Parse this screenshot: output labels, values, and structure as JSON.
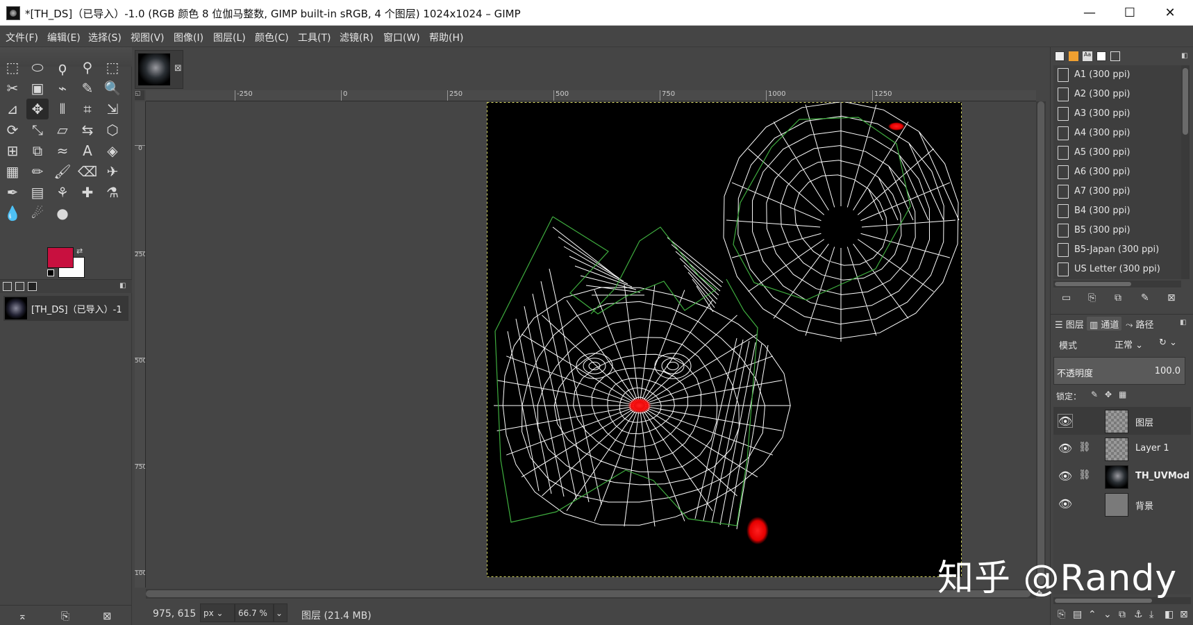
{
  "window": {
    "title": "*[TH_DS]（已导入）-1.0 (RGB 颜色 8 位伽马整数, GIMP built-in sRGB, 4 个图层) 1024x1024 – GIMP",
    "minimize": "—",
    "maximize": "☐",
    "close": "✕"
  },
  "menu": [
    "文件(F)",
    "编辑(E)",
    "选择(S)",
    "视图(V)",
    "图像(I)",
    "图层(L)",
    "颜色(C)",
    "工具(T)",
    "滤镜(R)",
    "窗口(W)",
    "帮助(H)"
  ],
  "colors": {
    "foreground": "#c8103f",
    "background": "#ffffff",
    "wireframe": "#ffffff",
    "seam": "#3fae3f",
    "hotspot": "#ff1a1a"
  },
  "toolbox": {
    "tools": [
      [
        "rect-select-icon",
        "ellipse-select-icon",
        "free-select-icon",
        "fuzzy-select-icon",
        "select-by-color-icon"
      ],
      [
        "scissors-icon",
        "foreground-select-icon",
        "paths-icon",
        "color-picker-icon",
        "zoom-icon"
      ],
      [
        "measure-icon",
        "move-icon",
        "align-icon",
        "crop-icon",
        "unified-transform-icon"
      ],
      [
        "rotate-icon",
        "scale-icon",
        "shear-icon",
        "flip-icon",
        "perspective-icon"
      ],
      [
        "handle-transform-icon",
        "cage-icon",
        "warp-icon",
        "text-icon",
        "bucket-fill-icon"
      ],
      [
        "gradient-icon",
        "pencil-icon",
        "paintbrush-icon",
        "eraser-icon",
        "airbrush-icon"
      ],
      [
        "ink-icon",
        "mypaint-icon",
        "clone-icon",
        "heal-icon",
        "perspective-clone-icon"
      ],
      [
        "blur-icon",
        "smudge-icon",
        "dodge-icon"
      ]
    ],
    "glyphs": [
      [
        "⬚",
        "⬭",
        "ϙ",
        "⚲",
        "⬚"
      ],
      [
        "✂",
        "▣",
        "⌁",
        "✎",
        "🔍"
      ],
      [
        "⊿",
        "✥",
        "⫴",
        "⌗",
        "⇲"
      ],
      [
        "⟳",
        "⤡",
        "▱",
        "⇆",
        "⬡"
      ],
      [
        "⊞",
        "⧉",
        "≈",
        "A",
        "◈"
      ],
      [
        "▦",
        "✏",
        "🖌",
        "⌫",
        "✈"
      ],
      [
        "✒",
        "▤",
        "⚘",
        "✚",
        "⚗"
      ],
      [
        "💧",
        "☄",
        "●"
      ]
    ],
    "image_entry": "[TH_DS]（已导入）-1"
  },
  "canvas": {
    "tab_close": "⊠",
    "ruler_h": [
      "-250",
      "0",
      "250",
      "500",
      "750",
      "1000",
      "1250"
    ],
    "ruler_v": [
      "0",
      "250",
      "500",
      "750",
      "1000"
    ],
    "coords": "975, 615",
    "unit": "px",
    "zoom": "66.7 %",
    "status": "图层 (21.4 MB)"
  },
  "templates": {
    "items": [
      "A1 (300 ppi)",
      "A2 (300 ppi)",
      "A3 (300 ppi)",
      "A4 (300 ppi)",
      "A5 (300 ppi)",
      "A6 (300 ppi)",
      "A7 (300 ppi)",
      "B4 (300 ppi)",
      "B5 (300 ppi)",
      "B5-Japan (300 ppi)",
      "US Letter (300 ppi)"
    ]
  },
  "layers": {
    "tabs": [
      "图层",
      "通道",
      "路径"
    ],
    "mode_label": "模式",
    "mode_value": "正常",
    "opacity_label": "不透明度",
    "opacity_value": "100.0",
    "lock_label": "锁定：",
    "items": [
      {
        "name": "图层",
        "bold": false,
        "linked": false,
        "thumb": "checker"
      },
      {
        "name": "Layer 1",
        "bold": false,
        "linked": true,
        "thumb": "checker"
      },
      {
        "name": "TH_UVMod",
        "bold": true,
        "linked": true,
        "thumb": "uv"
      },
      {
        "name": "背景",
        "bold": false,
        "linked": false,
        "thumb": "gray"
      }
    ]
  },
  "watermark": "知乎 @Randy"
}
